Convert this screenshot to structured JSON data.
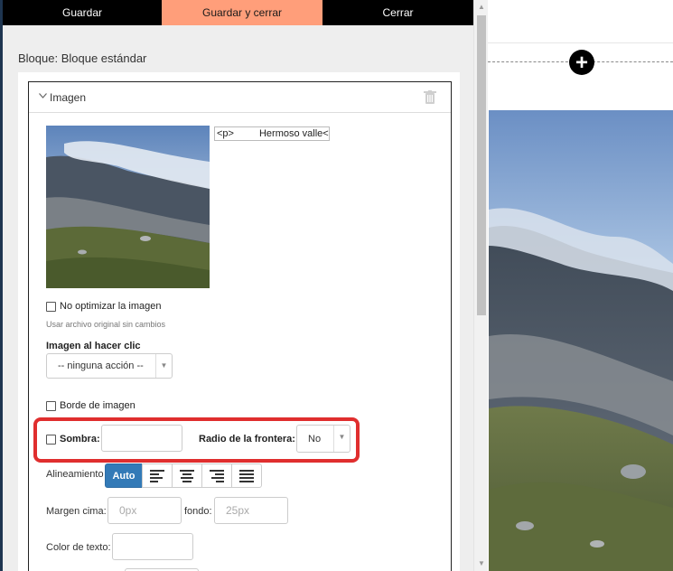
{
  "toolbar": {
    "save": "Guardar",
    "save_close": "Guardar y cerrar",
    "close": "Cerrar"
  },
  "block_title": "Bloque: Bloque estándar",
  "panel": {
    "title": "Imagen",
    "caption_tag": "<p>",
    "caption_text": "Hermoso valle<",
    "no_optimize_label": "No optimizar la imagen",
    "no_optimize_note": "Usar archivo original sin cambios",
    "click_label": "Imagen al hacer clic",
    "click_value": "-- ninguna acción --",
    "border_label": "Borde de imagen",
    "shadow_label": "Sombra:",
    "radius_label": "Radio de la frontera:",
    "radius_value": "No",
    "align_label": "Alineamiento",
    "align_auto": "Auto",
    "margin_top_label": "Margen cima:",
    "margin_top_placeholder": "0px",
    "margin_bottom_label": "fondo:",
    "margin_bottom_placeholder": "25px",
    "text_color_label": "Color de texto:"
  },
  "icons": {
    "add": "plus-circle-icon",
    "trash": "trash-icon",
    "chevron": "chevron-down-icon"
  },
  "colors": {
    "accent": "#ff9e7a",
    "primary": "#337ab7",
    "highlight": "#e02e2e"
  }
}
